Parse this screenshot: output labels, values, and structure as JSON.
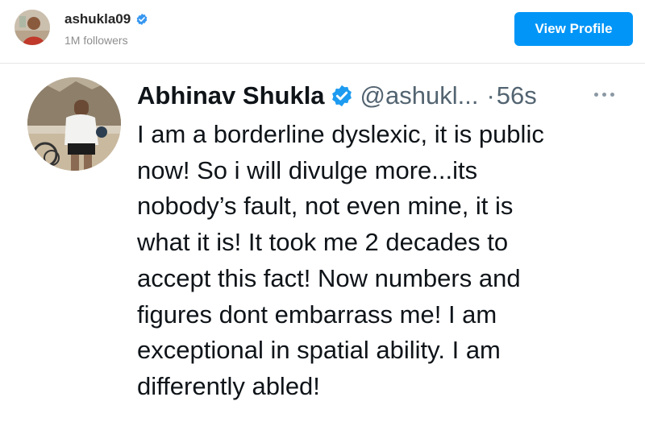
{
  "embed": {
    "username": "ashukla09",
    "followers": "1M followers",
    "view_profile_label": "View Profile",
    "accent_color": "#0095f6"
  },
  "tweet": {
    "name": "Abhinav Shukla",
    "handle": "@ashukl...",
    "separator": "·",
    "time": "56s",
    "verified_color": "#1d9bf0",
    "lines": [
      "I am a borderline dyslexic, it is public",
      "now! So i will divulge more...its",
      "nobody’s fault, not even mine, it is",
      "what it is! It took me 2 decades to",
      "accept this fact! Now numbers and",
      "figures dont embarrass me! I am",
      "exceptional in spatial ability. I am",
      "differently abled!"
    ]
  },
  "icons": {
    "verified": "verified-badge-icon",
    "more": "more-options-icon"
  }
}
